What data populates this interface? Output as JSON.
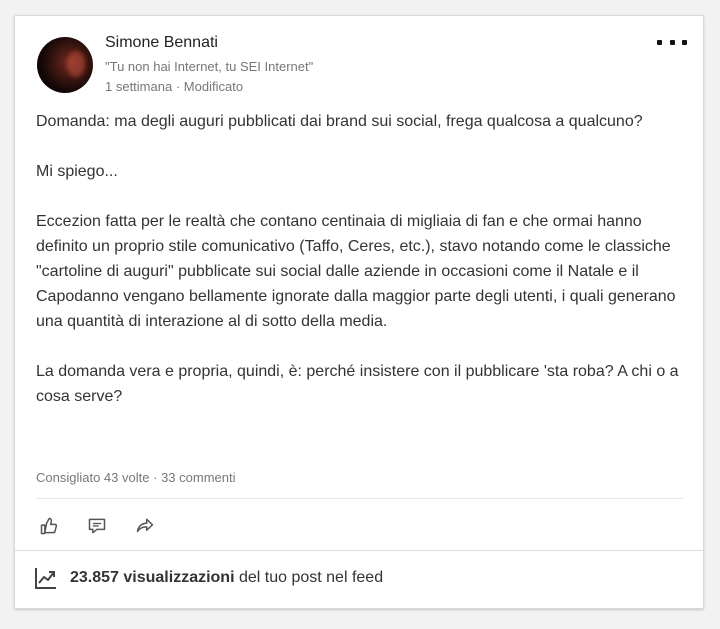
{
  "post": {
    "author": {
      "name": "Simone Bennati",
      "headline": "\"Tu non hai Internet, tu SEI Internet\"",
      "time": "1 settimana",
      "separator": "·",
      "edited": "Modificato"
    },
    "more_menu_icon": "three-dots-icon",
    "paragraphs": [
      "Domanda: ma degli auguri pubblicati dai brand sui social, frega qualcosa a qualcuno?",
      "Mi spiego...",
      "Eccezion fatta per le realtà che contano centinaia di migliaia di fan e che ormai hanno definito un proprio stile comunicativo (Taffo, Ceres, etc.), stavo notando come le classiche \"cartoline di auguri\" pubblicate sui social dalle aziende in occasioni come il Natale e il Capodanno vengano bellamente ignorate dalla maggior parte degli utenti, i quali generano una quantità di interazione al di sotto della media.",
      "La domanda vera e propria, quindi, è: perché insistere con il pubblicare 'sta roba? A chi o a cosa serve?"
    ],
    "stats": {
      "likes": "Consigliato 43 volte",
      "separator": "·",
      "comments": "33 commenti"
    },
    "actions": {
      "like_icon": "thumbs-up-icon",
      "comment_icon": "comment-icon",
      "share_icon": "share-arrow-icon"
    },
    "views": {
      "icon": "trending-chart-icon",
      "count": "23.857 visualizzazioni",
      "suffix": " del tuo post nel feed"
    }
  },
  "colors": {
    "background": "#f2f2f2",
    "card": "#ffffff",
    "text": "#333333",
    "muted": "#777777"
  }
}
